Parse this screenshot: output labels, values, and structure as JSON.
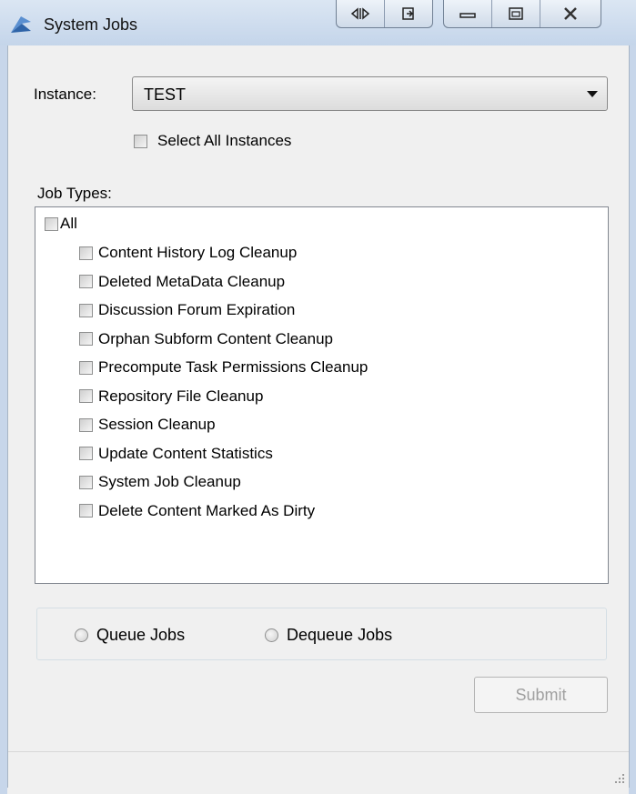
{
  "window": {
    "title": "System Jobs"
  },
  "instance": {
    "label": "Instance:",
    "selected": "TEST"
  },
  "select_all_instances": {
    "label": "Select All Instances",
    "checked": false
  },
  "job_types": {
    "label": "Job Types:",
    "all_label": "All",
    "items": [
      {
        "label": "Content History Log Cleanup",
        "checked": false
      },
      {
        "label": "Deleted MetaData Cleanup",
        "checked": false
      },
      {
        "label": "Discussion Forum Expiration",
        "checked": false
      },
      {
        "label": "Orphan Subform Content Cleanup",
        "checked": false
      },
      {
        "label": "Precompute Task Permissions Cleanup",
        "checked": false
      },
      {
        "label": "Repository File Cleanup",
        "checked": false
      },
      {
        "label": "Session Cleanup",
        "checked": false
      },
      {
        "label": "Update Content Statistics",
        "checked": false
      },
      {
        "label": "System Job Cleanup",
        "checked": false
      },
      {
        "label": "Delete Content Marked As Dirty",
        "checked": false
      }
    ]
  },
  "actions": {
    "queue_label": "Queue Jobs",
    "dequeue_label": "Dequeue Jobs",
    "submit_label": "Submit"
  },
  "colors": {
    "titlebar": "#c4d5ea",
    "background": "#f0f0f0",
    "disabled_text": "#a0a0a0"
  }
}
